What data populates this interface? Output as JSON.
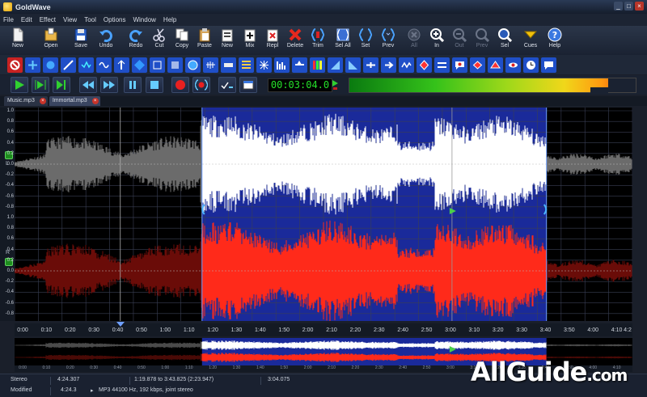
{
  "window": {
    "title": "GoldWave"
  },
  "menu": [
    "File",
    "Edit",
    "Effect",
    "View",
    "Tool",
    "Options",
    "Window",
    "Help"
  ],
  "toolbar": {
    "buttons": [
      {
        "label": "New",
        "icon": "new-file-icon"
      },
      {
        "label": "Open",
        "icon": "open-folder-icon"
      },
      {
        "label": "Save",
        "icon": "save-disk-icon"
      },
      {
        "label": "Undo",
        "icon": "undo-icon"
      },
      {
        "label": "Redo",
        "icon": "redo-icon"
      },
      {
        "label": "Cut",
        "icon": "scissors-icon"
      },
      {
        "label": "Copy",
        "icon": "copy-icon"
      },
      {
        "label": "Paste",
        "icon": "paste-icon"
      },
      {
        "label": "New",
        "icon": "paste-new-icon"
      },
      {
        "label": "Mix",
        "icon": "mix-icon"
      },
      {
        "label": "Repl",
        "icon": "replace-icon"
      },
      {
        "label": "Delete",
        "icon": "delete-x-icon"
      },
      {
        "label": "Trim",
        "icon": "trim-icon"
      },
      {
        "label": "Sel All",
        "icon": "select-all-icon"
      },
      {
        "label": "Set",
        "icon": "set-marker-icon"
      },
      {
        "label": "Prev",
        "icon": "previous-icon"
      },
      {
        "label": "All",
        "icon": "zoom-all-icon"
      },
      {
        "label": "In",
        "icon": "zoom-in-icon"
      },
      {
        "label": "Out",
        "icon": "zoom-out-icon"
      },
      {
        "label": "Prev",
        "icon": "zoom-prev-icon"
      },
      {
        "label": "Sel",
        "icon": "zoom-sel-icon"
      },
      {
        "label": "Cues",
        "icon": "cues-icon"
      },
      {
        "label": "Help",
        "icon": "help-icon"
      }
    ]
  },
  "transport": {
    "time": "00:03:04.0",
    "play_icon": "play-icon",
    "record_icon": "record-icon",
    "stop_icon": "stop-icon"
  },
  "level_meter": {
    "level": 0.9
  },
  "tabs": [
    {
      "label": "Music.mp3",
      "active": false
    },
    {
      "label": "Immortal.mp3",
      "active": true
    }
  ],
  "channels": [
    {
      "tag": "L",
      "color": "#ffffff",
      "dim_color": "#6b6b6b"
    },
    {
      "tag": "R",
      "color": "#ff2a1a",
      "dim_color": "#6a0c08"
    }
  ],
  "y_axis_labels": [
    "1.0",
    "0.8",
    "0.6",
    "0.4",
    "0.2",
    "0.0",
    "-0.2",
    "-0.4",
    "-0.6",
    "-0.8"
  ],
  "selection": {
    "start_seconds": 78.878,
    "end_seconds": 223.825,
    "cursor_seconds": 184.075,
    "marker_seconds": 44.5
  },
  "timeline": {
    "total_seconds": 260,
    "labels": [
      "0:00",
      "0:10",
      "0:20",
      "0:30",
      "0:40",
      "0:50",
      "1:00",
      "1:10",
      "1:20",
      "1:30",
      "1:40",
      "1:50",
      "2:00",
      "2:10",
      "2:20",
      "2:30",
      "2:40",
      "2:50",
      "3:00",
      "3:10",
      "3:20",
      "3:30",
      "3:40",
      "3:50",
      "4:00",
      "4:10",
      "4:2"
    ]
  },
  "overview_axis": {
    "labels": [
      "0:00",
      "0:10",
      "0:20",
      "0:30",
      "0:40",
      "0:50",
      "1:00",
      "1:10",
      "1:20",
      "1:30",
      "1:40",
      "1:50",
      "2:00",
      "2:10",
      "2:20",
      "2:30",
      "2:40",
      "2:50",
      "3:00",
      "3:10",
      "3:20",
      "3:30",
      "3:40",
      "3:50",
      "4:00",
      "4:10"
    ]
  },
  "status": {
    "channels": "Stereo",
    "length": "4:24.307",
    "selection": "1:19.878 to 3:43.825 (2:23.947)",
    "position": "3:04.075",
    "state": "Modified",
    "length2": "4:24.3",
    "format": "MP3 44100 Hz, 192 kbps, joint stereo"
  },
  "watermark": {
    "main": "AllGuide",
    "suffix": ".com"
  }
}
